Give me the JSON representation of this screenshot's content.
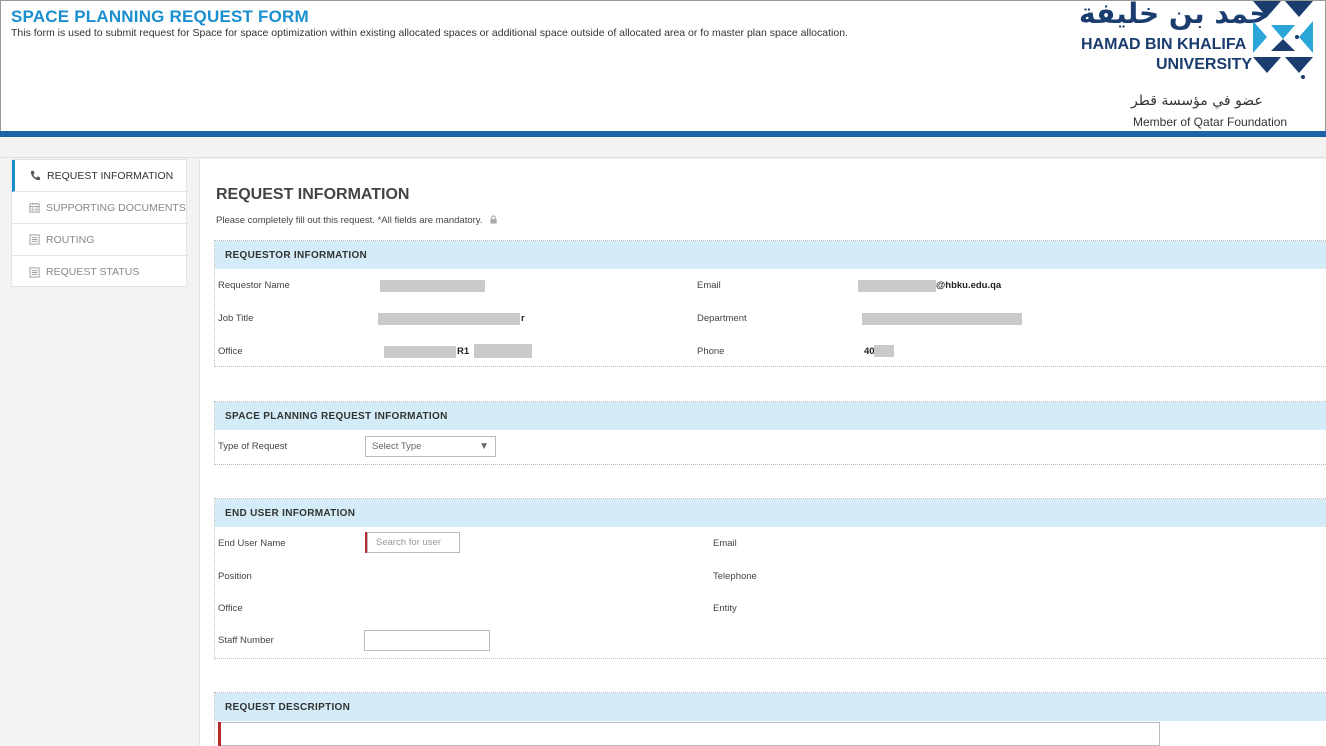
{
  "header": {
    "title": "SPACE PLANNING REQUEST FORM",
    "subtitle": "This form is used to submit request for Space for space optimization within existing allocated spaces or additional space outside of allocated area or fo master plan space allocation.",
    "logo_arabic": "حمد بن خليفة",
    "logo_en_line1": "HAMAD BIN KHALIFA",
    "logo_en_line2": "UNIVERSITY",
    "qf_arabic": "عضو في مؤسسة قطر",
    "qf_english": "Member of Qatar Foundation"
  },
  "sidebar": {
    "items": [
      {
        "label": "REQUEST INFORMATION",
        "icon": "phone-icon"
      },
      {
        "label": "SUPPORTING DOCUMENTS",
        "icon": "calendar-icon"
      },
      {
        "label": "ROUTING",
        "icon": "form-icon"
      },
      {
        "label": "REQUEST STATUS",
        "icon": "form-icon"
      }
    ]
  },
  "main": {
    "title": "REQUEST INFORMATION",
    "instructions": "Please completely fill out this request. *All fields are mandatory."
  },
  "requestor": {
    "heading": "REQUESTOR INFORMATION",
    "name_label": "Requestor Name",
    "email_label": "Email",
    "email_value": "@hbku.edu.qa",
    "job_label": "Job Title",
    "job_value": "r",
    "dept_label": "Department",
    "office_label": "Office",
    "office_value": "R1",
    "phone_label": "Phone",
    "phone_value": "40"
  },
  "space_request": {
    "heading": "SPACE PLANNING REQUEST INFORMATION",
    "type_label": "Type of Request",
    "type_selected": "Select Type"
  },
  "end_user": {
    "heading": "END USER INFORMATION",
    "name_label": "End User Name",
    "search_placeholder": "Search for user",
    "email_label": "Email",
    "position_label": "Position",
    "telephone_label": "Telephone",
    "office_label": "Office",
    "entity_label": "Entity",
    "staff_label": "Staff Number",
    "staff_value": ""
  },
  "description": {
    "heading": "REQUEST DESCRIPTION"
  },
  "colors": {
    "title_blue": "#1a8fd0",
    "header_bar": "#1d63a8",
    "section_bg": "#d3ecf7",
    "required_marker": "#b52b2b",
    "logo_navy": "#1a3c6e",
    "logo_light_blue": "#2aa5d8"
  }
}
